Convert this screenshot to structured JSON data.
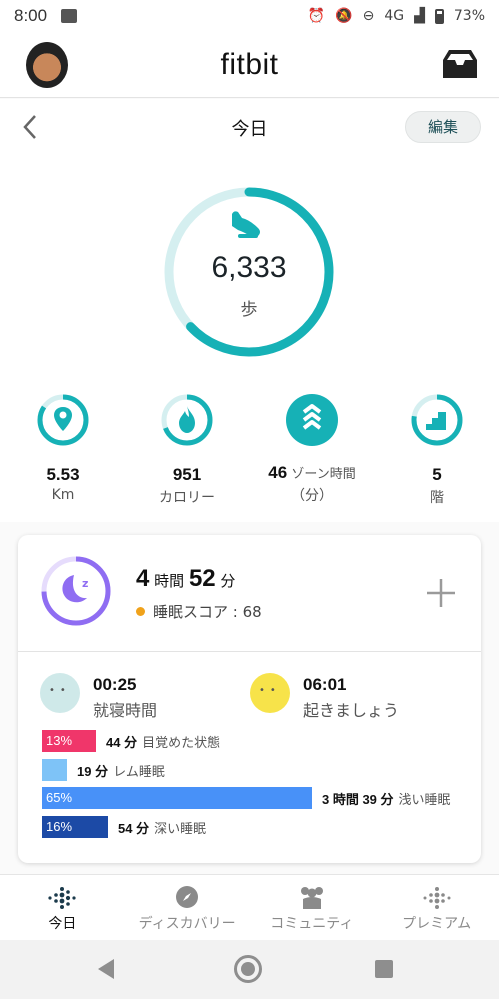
{
  "status_bar": {
    "time": "8:00",
    "network": "4G",
    "battery": "73%"
  },
  "header": {
    "brand": "fitbit"
  },
  "subheader": {
    "title": "今日",
    "edit_label": "編集"
  },
  "steps": {
    "value": "6,333",
    "unit": "歩",
    "progress": 0.63
  },
  "stats": [
    {
      "value": "5.53",
      "unit": "Km"
    },
    {
      "value": "951",
      "unit": "カロリー"
    },
    {
      "value": "46",
      "label": "ゾーン時間",
      "unit": "（分）"
    },
    {
      "value": "5",
      "unit": "階"
    }
  ],
  "sleep": {
    "hours": "4",
    "hours_unit": "時間",
    "minutes": "52",
    "minutes_unit": "分",
    "score_label": "睡眠スコア : 68",
    "bedtime": "00:25",
    "bedtime_label": "就寝時間",
    "waketime": "06:01",
    "waketime_label": "起きましょう",
    "stages": [
      {
        "pct": "13%",
        "fraction": 0.13,
        "duration": "44 分",
        "name": "目覚めた状態",
        "color": "#f0366a"
      },
      {
        "pct": "",
        "fraction": 0.06,
        "duration": "19 分",
        "name": "レム睡眠",
        "color": "#7ec3f7"
      },
      {
        "pct": "65%",
        "fraction": 0.65,
        "duration": "3 時間 39 分",
        "name": "浅い睡眠",
        "color": "#4891f8"
      },
      {
        "pct": "16%",
        "fraction": 0.16,
        "duration": "54 分",
        "name": "深い睡眠",
        "color": "#1c4aa6"
      }
    ]
  },
  "bottom_nav": [
    {
      "label": "今日"
    },
    {
      "label": "ディスカバリー"
    },
    {
      "label": "コミュニティ"
    },
    {
      "label": "プレミアム"
    }
  ],
  "colors": {
    "teal": "#16b1b6",
    "teal_light": "#d5eff0",
    "sleep_purple": "#8f6df2"
  }
}
